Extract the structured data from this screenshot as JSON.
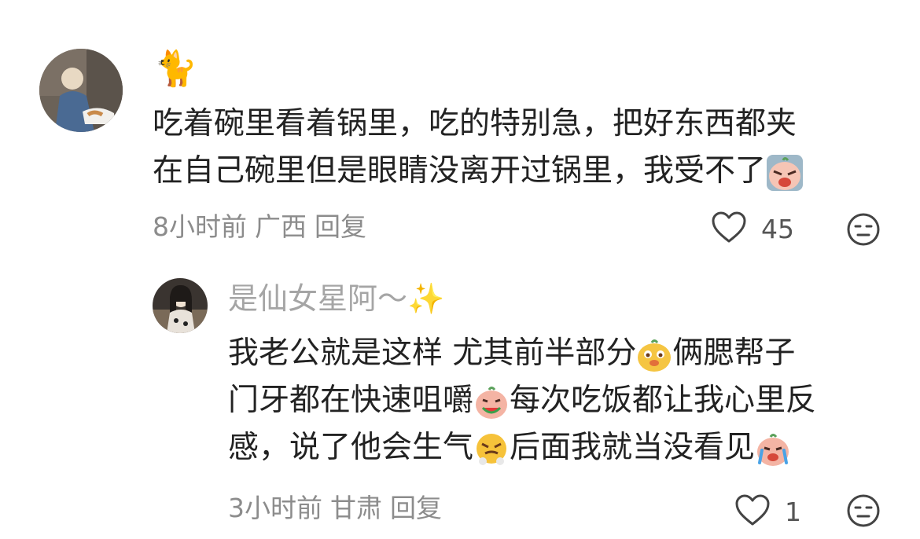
{
  "comments": [
    {
      "username_emoji": "🐈",
      "text_line1": "吃着碗里看着锅里，吃的特别急，把好东西都夹",
      "text_line2": "在自己碗里但是眼睛没离开过锅里，我受不了",
      "time": "8小时前",
      "location": "广西",
      "reply_label": "回复",
      "likes": "45"
    },
    {
      "username": "是仙女星阿～✨",
      "text_line1_a": "我老公就是这样 尤其前半部分",
      "text_line1_b": "俩腮帮子",
      "text_line2_a": "门牙都在快速咀嚼",
      "text_line2_b": "每次吃饭都让我心里反",
      "text_line3_a": "感，说了他会生气",
      "text_line3_b": "后面我就当没看见",
      "time": "3小时前",
      "location": "甘肃",
      "reply_label": "回复",
      "likes": "1"
    }
  ],
  "icons": {
    "like": "heart-outline-icon",
    "dislike": "neutral-face-icon",
    "accent_gray": "#8c8c8c"
  }
}
